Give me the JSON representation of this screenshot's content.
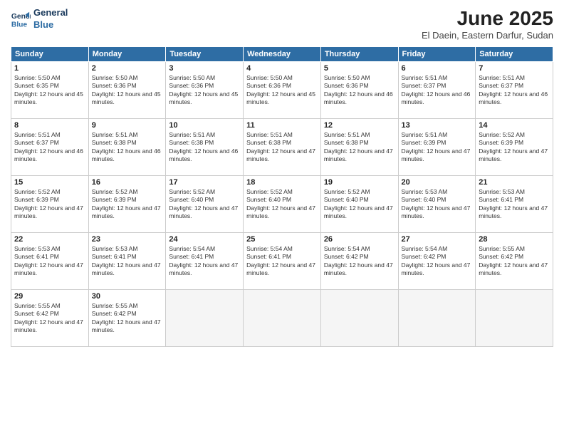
{
  "logo": {
    "line1": "General",
    "line2": "Blue"
  },
  "title": "June 2025",
  "location": "El Daein, Eastern Darfur, Sudan",
  "weekdays": [
    "Sunday",
    "Monday",
    "Tuesday",
    "Wednesday",
    "Thursday",
    "Friday",
    "Saturday"
  ],
  "weeks": [
    [
      {
        "day": "1",
        "sunrise": "5:50 AM",
        "sunset": "6:35 PM",
        "daylight": "12 hours and 45 minutes."
      },
      {
        "day": "2",
        "sunrise": "5:50 AM",
        "sunset": "6:36 PM",
        "daylight": "12 hours and 45 minutes."
      },
      {
        "day": "3",
        "sunrise": "5:50 AM",
        "sunset": "6:36 PM",
        "daylight": "12 hours and 45 minutes."
      },
      {
        "day": "4",
        "sunrise": "5:50 AM",
        "sunset": "6:36 PM",
        "daylight": "12 hours and 45 minutes."
      },
      {
        "day": "5",
        "sunrise": "5:50 AM",
        "sunset": "6:36 PM",
        "daylight": "12 hours and 46 minutes."
      },
      {
        "day": "6",
        "sunrise": "5:51 AM",
        "sunset": "6:37 PM",
        "daylight": "12 hours and 46 minutes."
      },
      {
        "day": "7",
        "sunrise": "5:51 AM",
        "sunset": "6:37 PM",
        "daylight": "12 hours and 46 minutes."
      }
    ],
    [
      {
        "day": "8",
        "sunrise": "5:51 AM",
        "sunset": "6:37 PM",
        "daylight": "12 hours and 46 minutes."
      },
      {
        "day": "9",
        "sunrise": "5:51 AM",
        "sunset": "6:38 PM",
        "daylight": "12 hours and 46 minutes."
      },
      {
        "day": "10",
        "sunrise": "5:51 AM",
        "sunset": "6:38 PM",
        "daylight": "12 hours and 46 minutes."
      },
      {
        "day": "11",
        "sunrise": "5:51 AM",
        "sunset": "6:38 PM",
        "daylight": "12 hours and 47 minutes."
      },
      {
        "day": "12",
        "sunrise": "5:51 AM",
        "sunset": "6:38 PM",
        "daylight": "12 hours and 47 minutes."
      },
      {
        "day": "13",
        "sunrise": "5:51 AM",
        "sunset": "6:39 PM",
        "daylight": "12 hours and 47 minutes."
      },
      {
        "day": "14",
        "sunrise": "5:52 AM",
        "sunset": "6:39 PM",
        "daylight": "12 hours and 47 minutes."
      }
    ],
    [
      {
        "day": "15",
        "sunrise": "5:52 AM",
        "sunset": "6:39 PM",
        "daylight": "12 hours and 47 minutes."
      },
      {
        "day": "16",
        "sunrise": "5:52 AM",
        "sunset": "6:39 PM",
        "daylight": "12 hours and 47 minutes."
      },
      {
        "day": "17",
        "sunrise": "5:52 AM",
        "sunset": "6:40 PM",
        "daylight": "12 hours and 47 minutes."
      },
      {
        "day": "18",
        "sunrise": "5:52 AM",
        "sunset": "6:40 PM",
        "daylight": "12 hours and 47 minutes."
      },
      {
        "day": "19",
        "sunrise": "5:52 AM",
        "sunset": "6:40 PM",
        "daylight": "12 hours and 47 minutes."
      },
      {
        "day": "20",
        "sunrise": "5:53 AM",
        "sunset": "6:40 PM",
        "daylight": "12 hours and 47 minutes."
      },
      {
        "day": "21",
        "sunrise": "5:53 AM",
        "sunset": "6:41 PM",
        "daylight": "12 hours and 47 minutes."
      }
    ],
    [
      {
        "day": "22",
        "sunrise": "5:53 AM",
        "sunset": "6:41 PM",
        "daylight": "12 hours and 47 minutes."
      },
      {
        "day": "23",
        "sunrise": "5:53 AM",
        "sunset": "6:41 PM",
        "daylight": "12 hours and 47 minutes."
      },
      {
        "day": "24",
        "sunrise": "5:54 AM",
        "sunset": "6:41 PM",
        "daylight": "12 hours and 47 minutes."
      },
      {
        "day": "25",
        "sunrise": "5:54 AM",
        "sunset": "6:41 PM",
        "daylight": "12 hours and 47 minutes."
      },
      {
        "day": "26",
        "sunrise": "5:54 AM",
        "sunset": "6:42 PM",
        "daylight": "12 hours and 47 minutes."
      },
      {
        "day": "27",
        "sunrise": "5:54 AM",
        "sunset": "6:42 PM",
        "daylight": "12 hours and 47 minutes."
      },
      {
        "day": "28",
        "sunrise": "5:55 AM",
        "sunset": "6:42 PM",
        "daylight": "12 hours and 47 minutes."
      }
    ],
    [
      {
        "day": "29",
        "sunrise": "5:55 AM",
        "sunset": "6:42 PM",
        "daylight": "12 hours and 47 minutes."
      },
      {
        "day": "30",
        "sunrise": "5:55 AM",
        "sunset": "6:42 PM",
        "daylight": "12 hours and 47 minutes."
      },
      null,
      null,
      null,
      null,
      null
    ]
  ]
}
